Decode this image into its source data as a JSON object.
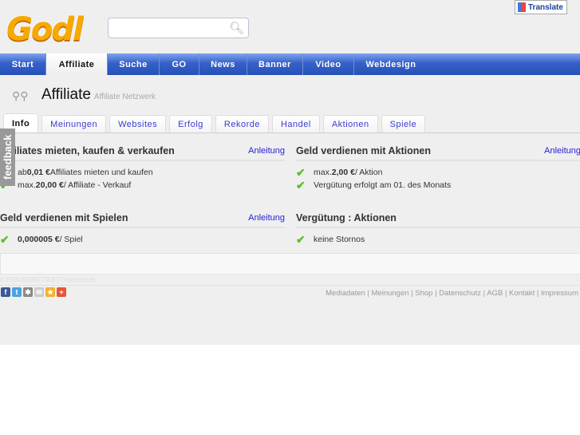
{
  "header": {
    "logo": "Godl",
    "search_placeholder": "",
    "translate": "Translate"
  },
  "nav": [
    "Start",
    "Affiliate",
    "Suche",
    "GO",
    "News",
    "Banner",
    "Video",
    "Webdesign"
  ],
  "page": {
    "title": "Affiliate",
    "subtitle": "Affiliate Netzwerk"
  },
  "tabs": [
    "Info",
    "Meinungen",
    "Websites",
    "Erfolg",
    "Rekorde",
    "Handel",
    "Aktionen",
    "Spiele"
  ],
  "feedback": "feedback",
  "sections": [
    {
      "title": "Affiliates mieten, kaufen & verkaufen",
      "link": "Anleitung",
      "items": [
        {
          "pre": "ab ",
          "bold": "0,01 €",
          "post": " Affiliates mieten und kaufen"
        },
        {
          "pre": "max. ",
          "bold": "20,00 €",
          "post": " / Affiliate - Verkauf"
        }
      ]
    },
    {
      "title": "Geld verdienen mit Aktionen",
      "link": "Anleitung",
      "items": [
        {
          "pre": "max. ",
          "bold": "2,00 €",
          "post": " / Aktion"
        },
        {
          "pre": "Vergütung erfolgt am 01. des Monats",
          "bold": "",
          "post": ""
        }
      ]
    },
    {
      "title": "Geld verdienen mit Spielen",
      "link": "Anleitung",
      "items": [
        {
          "pre": "",
          "bold": "0,000005 €",
          "post": " / Spiel"
        }
      ]
    },
    {
      "title": "Vergütung : Aktionen",
      "link": "",
      "items": [
        {
          "pre": "keine Stornos",
          "bold": "",
          "post": ""
        }
      ]
    }
  ],
  "footer": {
    "stat": "0.15662693977358 | Thumbshots",
    "links": "Mediadaten | Meinungen | Shop | Datenschutz | AGB | Kontakt | Impressum",
    "social": [
      {
        "icon": "facebook-icon",
        "glyph": "f",
        "color": "#3b5998"
      },
      {
        "icon": "twitter-icon",
        "glyph": "t",
        "color": "#4aa3df"
      },
      {
        "icon": "settings-icon",
        "glyph": "✱",
        "color": "#888"
      },
      {
        "icon": "mail-icon",
        "glyph": "✉",
        "color": "#ccc"
      },
      {
        "icon": "favorite-icon",
        "glyph": "★",
        "color": "#f5b030"
      },
      {
        "icon": "add-icon",
        "glyph": "+",
        "color": "#e8553a"
      }
    ]
  }
}
